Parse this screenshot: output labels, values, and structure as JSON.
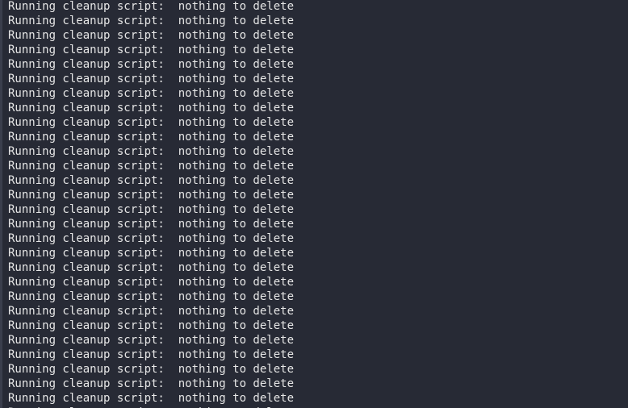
{
  "terminal": {
    "lines": [
      "Running cleanup script:  nothing to delete",
      "Running cleanup script:  nothing to delete",
      "Running cleanup script:  nothing to delete",
      "Running cleanup script:  nothing to delete",
      "Running cleanup script:  nothing to delete",
      "Running cleanup script:  nothing to delete",
      "Running cleanup script:  nothing to delete",
      "Running cleanup script:  nothing to delete",
      "Running cleanup script:  nothing to delete",
      "Running cleanup script:  nothing to delete",
      "Running cleanup script:  nothing to delete",
      "Running cleanup script:  nothing to delete",
      "Running cleanup script:  nothing to delete",
      "Running cleanup script:  nothing to delete",
      "Running cleanup script:  nothing to delete",
      "Running cleanup script:  nothing to delete",
      "Running cleanup script:  nothing to delete",
      "Running cleanup script:  nothing to delete",
      "Running cleanup script:  nothing to delete",
      "Running cleanup script:  nothing to delete",
      "Running cleanup script:  nothing to delete",
      "Running cleanup script:  nothing to delete",
      "Running cleanup script:  nothing to delete",
      "Running cleanup script:  nothing to delete",
      "Running cleanup script:  nothing to delete",
      "Running cleanup script:  nothing to delete",
      "Running cleanup script:  nothing to delete",
      "Running cleanup script:  nothing to delete",
      "Running cleanup script:  nothing to delete"
    ],
    "colors": {
      "background": "#272a35",
      "text": "#e6e6e6"
    }
  }
}
